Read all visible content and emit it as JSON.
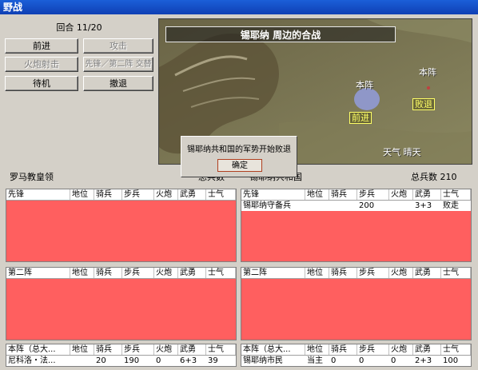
{
  "window": {
    "title": "野战"
  },
  "turn": {
    "label": "回合 11/20"
  },
  "buttons": {
    "advance": "前进",
    "attack": "攻击",
    "cannon": "火炮射击",
    "swap": "先锋／第二阵 交替",
    "standby": "待机",
    "retreat": "撤退"
  },
  "map": {
    "banner": "锡耶纳  周边的合战",
    "enemy_hq_label": "本阵",
    "own_hq_label": "本阵",
    "enemy_status_tag": "败退",
    "own_status_tag": "前进",
    "weather": "天气  晴天"
  },
  "dialog": {
    "message": "锡耶纳共和国的军势开始败退",
    "ok_label": "确定"
  },
  "left_info": {
    "name": "罗马教皇领",
    "total_label": "总兵数"
  },
  "right_info": {
    "name": "锡耶纳共和国",
    "total_label": "总兵数 210"
  },
  "columns": [
    "地位",
    "骑兵",
    "步兵",
    "火炮",
    "武勇",
    "士气"
  ],
  "left_panels": [
    {
      "title": "先锋",
      "rows": []
    },
    {
      "title": "第二阵",
      "rows": []
    },
    {
      "title": "本阵（总大...",
      "rows": [
        {
          "name": "尼科洛・法...",
          "rank": "",
          "cavalry": "20",
          "infantry": "190",
          "cannon": "0",
          "valor": "6+3",
          "morale": "39"
        }
      ]
    }
  ],
  "right_panels": [
    {
      "title": "先锋",
      "rows": [
        {
          "name": "锡耶纳守备兵",
          "rank": "",
          "cavalry": "",
          "infantry": "200",
          "cannon": "",
          "valor": "3+3",
          "morale": "败走"
        }
      ]
    },
    {
      "title": "第二阵",
      "rows": []
    },
    {
      "title": "本阵（总大...",
      "rows": [
        {
          "name": "锡耶纳市民",
          "rank": "当主",
          "cavalry": "0",
          "infantry": "0",
          "cannon": "0",
          "valor": "2+3",
          "morale": "100"
        }
      ]
    }
  ],
  "colors": {
    "panel_fill": "#ff5f5f",
    "tag": "#ffff66",
    "title_bar": "#1b5fd8"
  }
}
